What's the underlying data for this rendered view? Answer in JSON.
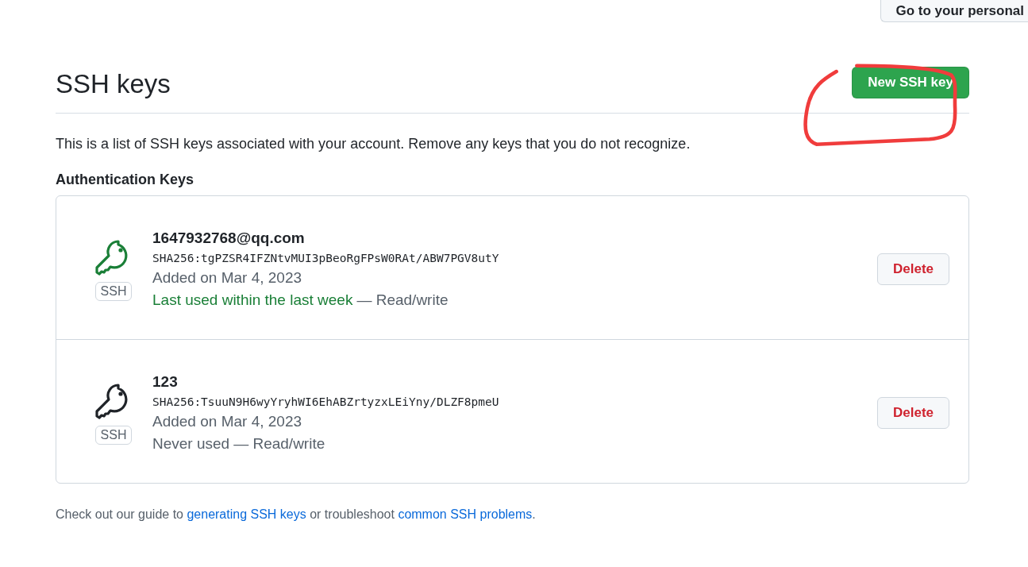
{
  "top_button": {
    "label": "Go to your personal"
  },
  "header": {
    "title": "SSH keys",
    "new_button": "New SSH key"
  },
  "description": "This is a list of SSH keys associated with your account. Remove any keys that you do not recognize.",
  "section_title": "Authentication Keys",
  "keys": [
    {
      "title": "1647932768@qq.com",
      "fingerprint": "SHA256:tgPZSR4IFZNtvMUI3pBeoRgFPsW0RAt/ABW7PGV8utY",
      "badge": "SSH",
      "added": "Added on Mar 4, 2023",
      "usage": "Last used within the last week",
      "recent": true,
      "access": "— Read/write",
      "delete": "Delete"
    },
    {
      "title": "123",
      "fingerprint": "SHA256:TsuuN9H6wyYryhWI6EhABZrtyzxLEiYny/DLZF8pmeU",
      "badge": "SSH",
      "added": "Added on Mar 4, 2023",
      "usage": "Never used",
      "recent": false,
      "access": "— Read/write",
      "delete": "Delete"
    }
  ],
  "footer": {
    "before": "Check out our guide to",
    "link1": "generating SSH keys",
    "middle": "or troubleshoot",
    "link2": "common SSH problems",
    "after": "."
  }
}
